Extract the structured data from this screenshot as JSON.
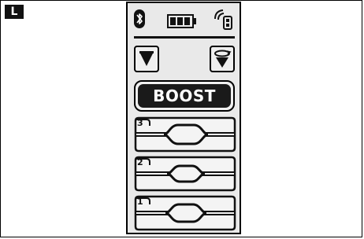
{
  "corner_label": "L",
  "status": {
    "bluetooth_icon": "bluetooth-icon",
    "battery_icon": "battery-icon",
    "signal_icon": "signal-icon"
  },
  "filters": {
    "left_icon": "funnel-icon",
    "right_icon": "funnel-rotate-icon"
  },
  "boost_label": "BOOST",
  "levels": [
    {
      "label": "3"
    },
    {
      "label": "2"
    },
    {
      "label": "1"
    }
  ]
}
